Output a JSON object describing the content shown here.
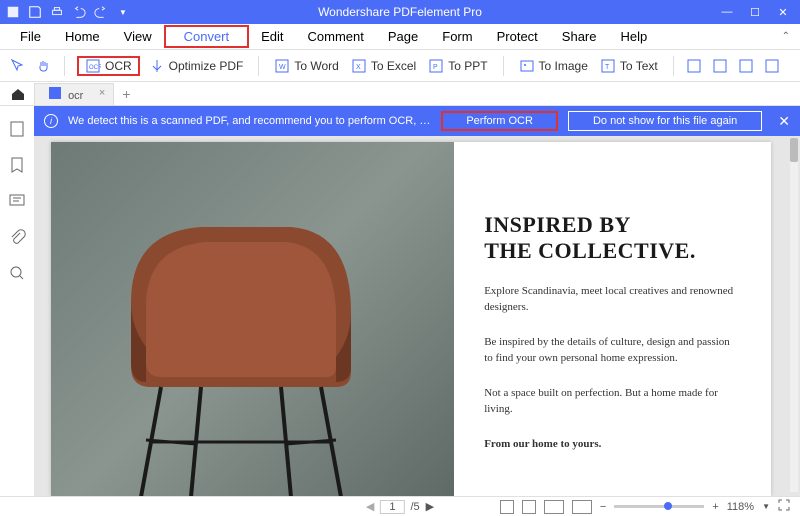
{
  "titlebar": {
    "title": "Wondershare PDFelement Pro"
  },
  "menu": {
    "items": [
      "File",
      "Home",
      "View",
      "Convert",
      "Edit",
      "Comment",
      "Page",
      "Form",
      "Protect",
      "Share",
      "Help"
    ],
    "highlight": "Convert"
  },
  "toolbar": {
    "ocr": "OCR",
    "optimize": "Optimize PDF",
    "toWord": "To Word",
    "toExcel": "To Excel",
    "toPPT": "To PPT",
    "toImage": "To Image",
    "toText": "To Text"
  },
  "tab": {
    "name": "ocr"
  },
  "banner": {
    "text": "We detect this is a scanned PDF, and recommend you to perform OCR, which enables you to ...",
    "perform": "Perform OCR",
    "dismiss": "Do not show for this file again"
  },
  "doc": {
    "h1": "INSPIRED BY",
    "h2": "THE COLLECTIVE.",
    "p1": "Explore Scandinavia, meet local creatives and renowned designers.",
    "p2": "Be inspired by the details of culture, design and passion to find your own personal home expression.",
    "p3": "Not a space built on perfection. But a home made for living.",
    "p4": "From our home to yours."
  },
  "status": {
    "page": "1",
    "pages": "/5",
    "zoom": "118%"
  }
}
